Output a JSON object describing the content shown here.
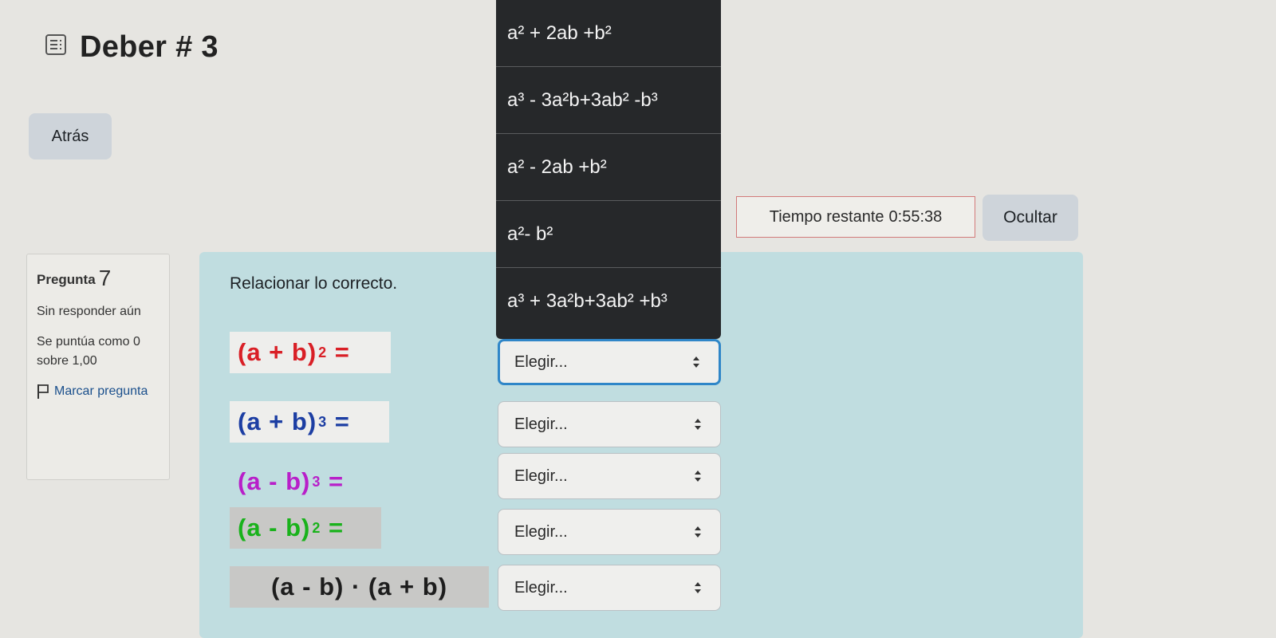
{
  "header": {
    "title": "Deber # 3",
    "back_label": "Atrás"
  },
  "timer": {
    "label": "Tiempo restante",
    "value": "0:55:38",
    "hide_label": "Ocultar"
  },
  "question_info": {
    "label": "Pregunta",
    "number": "7",
    "state": "Sin responder aún",
    "grade": "Se puntúa como 0 sobre 1,00",
    "flag_label": "Marcar pregunta"
  },
  "question": {
    "prompt": "Relacionar lo correcto.",
    "rows": [
      {
        "base": "(a + b)",
        "exp": "2",
        "eq": " =",
        "color": "#d91f26",
        "bg": "#eeeeec",
        "selected": "Elegir..."
      },
      {
        "base": "(a + b)",
        "exp": "3",
        "eq": " =",
        "color": "#1c3ea3",
        "bg": "#eeeeec",
        "selected": "Elegir..."
      },
      {
        "base": "(a - b)",
        "exp": "3",
        "eq": " =",
        "color": "#b81fc9",
        "bg": "#c0dde0",
        "selected": "Elegir..."
      },
      {
        "base": "(a - b)",
        "exp": "2",
        "eq": " =",
        "color": "#19b21b",
        "bg": "#c8c8c6",
        "selected": "Elegir..."
      },
      {
        "base": "(a - b) · (a + b)",
        "exp": "",
        "eq": "",
        "color": "#1d1d1d",
        "bg": "#c8c8c6",
        "selected": "Elegir..."
      }
    ]
  },
  "dropdown": {
    "options": [
      "a² + 2ab +b²",
      "a³ - 3a²b+3ab² -b³",
      "a² - 2ab +b²",
      "a²- b²",
      "a³ + 3a²b+3ab² +b³"
    ]
  },
  "colors": {
    "content_bg": "#c0dde0",
    "button_bg": "#ced4da",
    "focus_border": "#2f86c8",
    "dropdown_bg": "#26282a"
  }
}
